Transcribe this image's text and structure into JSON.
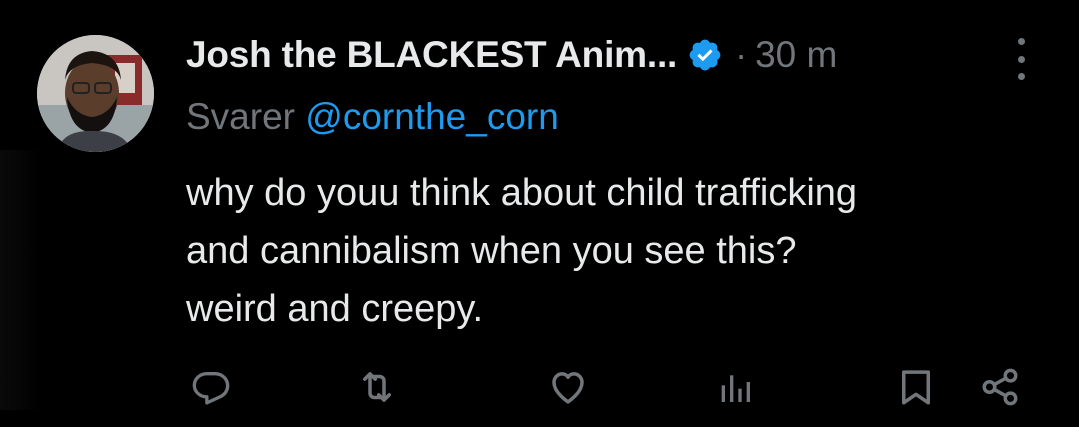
{
  "tweet": {
    "display_name": "Josh the BLACKEST Anim...",
    "separator": "·",
    "timestamp": "30 m",
    "reply_prefix": "Svarer",
    "reply_handle": "@cornthe_corn",
    "text": "why do youu think about child trafficking\nand cannibalism when you see this?\nweird and creepy."
  },
  "actions": [
    "reply-icon",
    "retweet-icon",
    "like-icon",
    "views-icon",
    "bookmark-icon",
    "share-icon"
  ],
  "colors": {
    "background": "#000000",
    "text": "#e7e9ea",
    "muted": "#71767b",
    "accent": "#1d9bf0"
  }
}
